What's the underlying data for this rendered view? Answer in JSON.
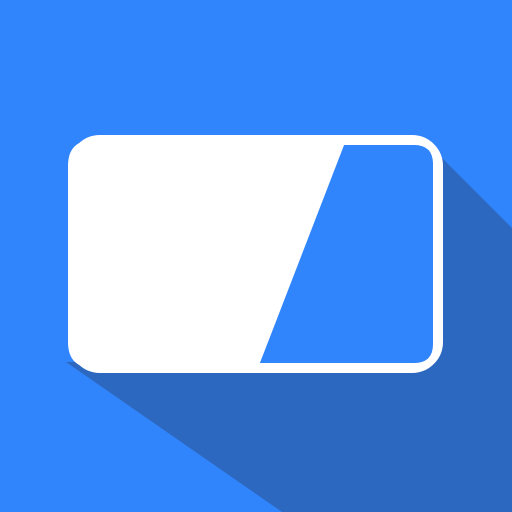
{
  "icon": {
    "name": "battery-card-icon",
    "colors": {
      "background": "#3185fc",
      "long_shadow": "#2c68bf",
      "card_fill": "#ffffff",
      "accent_fill": "#3185fc",
      "outline": "#ffffff"
    }
  }
}
